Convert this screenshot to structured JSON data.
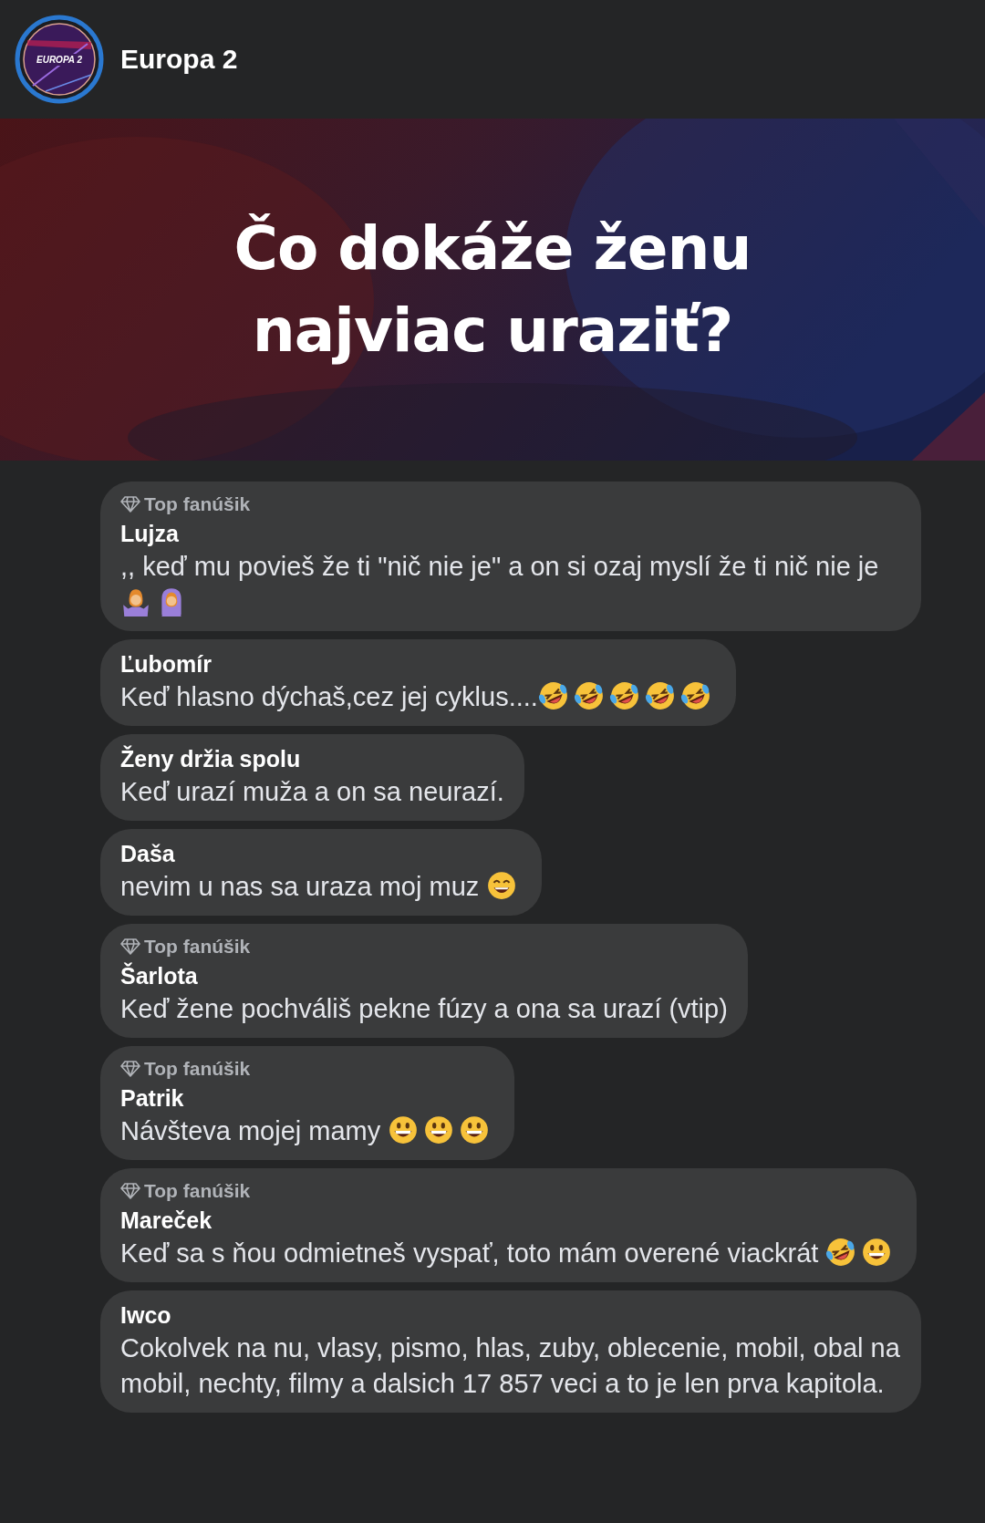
{
  "page": {
    "name": "Europa 2",
    "avatar_text": "EUROPA 2"
  },
  "post": {
    "title": "Čo dokáže ženu najviac uraziť?"
  },
  "comments": [
    {
      "badge": "Top fanúšik",
      "author": "Lujza",
      "text": ",, keď mu povieš že ti \"nič nie je\" a on si ozaj myslí že ti nič nie je",
      "emojis": [
        {
          "kind": "shrug"
        },
        {
          "kind": "hands-on-head"
        }
      ]
    },
    {
      "author": "Ľubomír",
      "text": "Keď hlasno dýchaš,cez jej cyklus....",
      "emojis": [
        {
          "kind": "rofl"
        },
        {
          "kind": "rofl"
        },
        {
          "kind": "rofl"
        },
        {
          "kind": "rofl"
        },
        {
          "kind": "rofl"
        }
      ]
    },
    {
      "author": "Ženy držia spolu",
      "text": "Keď urazí muža a on sa neurazí."
    },
    {
      "author": "Daša",
      "text": "nevim u nas sa uraza moj muz ",
      "emojis": [
        {
          "kind": "grin"
        }
      ]
    },
    {
      "badge": "Top fanúšik",
      "author": "Šarlota",
      "text": "Keď žene pochváliš pekne fúzy a ona sa urazí (vtip)"
    },
    {
      "badge": "Top fanúšik",
      "author": "Patrik",
      "text": "Návšteva mojej mamy ",
      "emojis": [
        {
          "kind": "grinning"
        },
        {
          "kind": "grinning"
        },
        {
          "kind": "grinning"
        }
      ]
    },
    {
      "badge": "Top fanúšik",
      "author": "Mareček",
      "text": "Keď sa s ňou odmietneš vyspať, toto mám overené viackrát ",
      "emojis": [
        {
          "kind": "rofl"
        },
        {
          "kind": "grinning"
        }
      ]
    },
    {
      "author": "Iwco",
      "text": "Cokolvek na nu, vlasy, pismo, hlas, zuby, oblecenie, mobil, obal na mobil, nechty, filmy a dalsich 17 857 veci a to je len prva kapitola."
    }
  ]
}
